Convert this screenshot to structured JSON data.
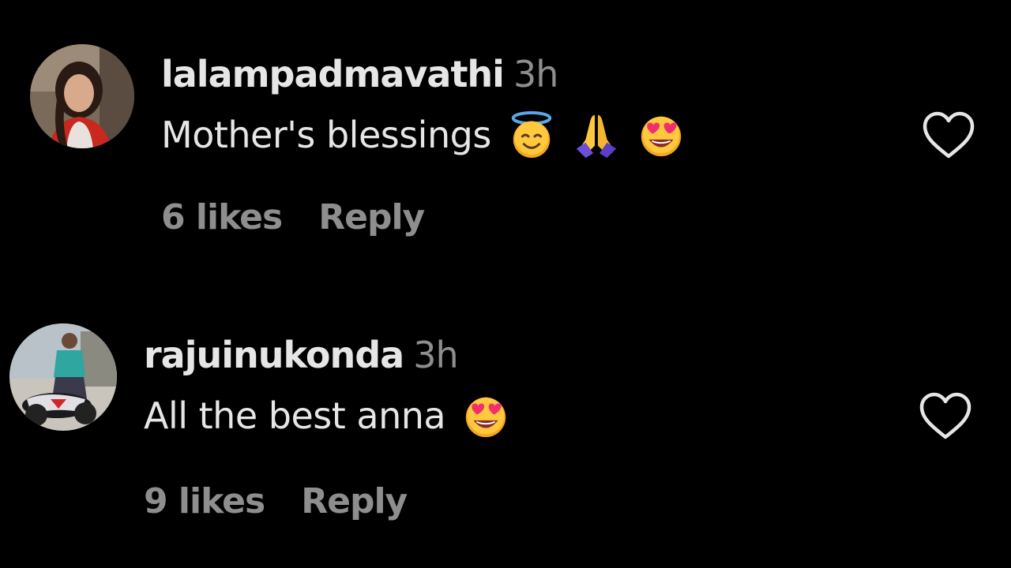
{
  "comments": [
    {
      "username": "lalampadmavathi",
      "time": "3h",
      "text": "Mother's blessings",
      "emojis": [
        "smiling-face-with-halo",
        "folded-hands",
        "smiling-face-with-heart-eyes"
      ],
      "likes": "6 likes",
      "reply": "Reply"
    },
    {
      "username": "rajuinukonda",
      "time": "3h",
      "text": "All the best anna",
      "emojis": [
        "smiling-face-with-heart-eyes"
      ],
      "likes": "9 likes",
      "reply": "Reply"
    }
  ],
  "colors": {
    "background": "#000000",
    "primary_text": "#e6e6e6",
    "secondary_text": "#8e8e8e",
    "heart_outline": "#e6e6e6"
  }
}
